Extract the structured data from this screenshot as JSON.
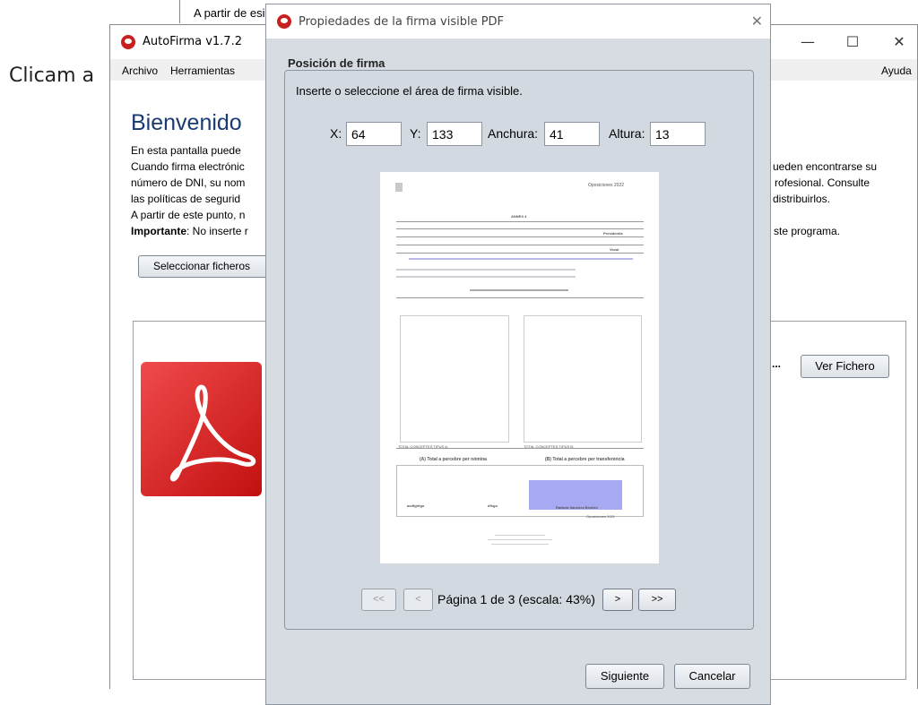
{
  "background": {
    "text_left": "Clicam a",
    "top_text": "A partir de esi"
  },
  "main_window": {
    "title": "AutoFirma v1.7.2",
    "controls": {
      "minimize": "—",
      "maximize": "☐",
      "close": "✕"
    },
    "menu": {
      "archivo": "Archivo",
      "herramientas": "Herramientas",
      "ayuda": "Ayuda"
    },
    "welcome": {
      "title": "Bienvenido",
      "lines_left": [
        "En esta pantalla puede",
        "Cuando firma electrónic",
        "número de DNI, su nom",
        "las políticas de segurid",
        "A partir de este punto, n"
      ],
      "important_label": "Importante",
      "important_rest": ": No inserte r",
      "lines_right": [
        "ueden encontrarse su",
        "rofesional. Consulte",
        "distribuirlos.",
        "",
        "ste programa."
      ],
      "select_files_button": "Seleccionar ficheros",
      "file_ellipsis": "...",
      "view_file_button": "Ver Fichero"
    }
  },
  "dialog": {
    "title": "Propiedades de la firma visible PDF",
    "close": "✕",
    "section_title": "Posición de firma",
    "instruction": "Inserte o seleccione el área de firma visible.",
    "fields": {
      "x_label": "X:",
      "x_value": "64",
      "y_label": "Y:",
      "y_value": "133",
      "width_label": "Anchura:",
      "width_value": "41",
      "height_label": "Altura:",
      "height_value": "13"
    },
    "preview": {
      "header_right": "Oposiciones 2022",
      "annex": "ANNEX 4",
      "row_label_1": "President/a",
      "row_label_2": "Vocal",
      "section_a": "(A) Total a percebre per nómina",
      "section_b": "(B) Total a percebre per transferència",
      "total_a": "TOTAL CONCEPTES TIPUS A:",
      "total_b": "TOTAL CONCEPTES TIPUS B:",
      "sign_name_1": "asdfghfgo",
      "sign_name_2": "dfsgo",
      "sign_name_3": "Rafaela Sánchez Benítez",
      "footer": "Oposiciones 2021"
    },
    "nav": {
      "first": "<<",
      "prev": "<",
      "page_info": "Página 1 de 3 (escala: 43%)",
      "next": ">",
      "last": ">>"
    },
    "next_button": "Siguiente",
    "cancel_button": "Cancelar"
  }
}
